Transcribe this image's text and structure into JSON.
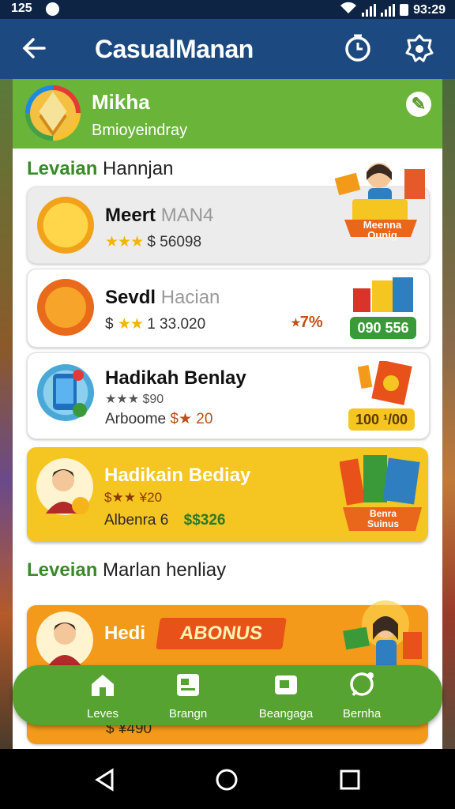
{
  "status_bar": {
    "time_left": "125",
    "time_right": "93:29"
  },
  "app_bar": {
    "back_icon": "arrow-left-icon",
    "title": "CasualManan",
    "icons": [
      "timer-icon",
      "settings-icon"
    ]
  },
  "profile": {
    "name": "Mikha",
    "subtitle": "Bmioyeindray",
    "edit_icon": "pencil-icon"
  },
  "sections": [
    {
      "title_green": "Levaian",
      "title_rest": " Hannjan"
    },
    {
      "title_green": "Leveian",
      "title_rest": " Marlan henliay"
    }
  ],
  "cards": [
    {
      "title": "Meert",
      "title_light": " MAN4",
      "stars": "★★★",
      "value": " $ 56098",
      "badge": "Meenna Ounig"
    },
    {
      "title": "Sevdl",
      "title_light": " Hacian",
      "stars": "★★",
      "value_prefix": "$ ",
      "value": " 1 33.020",
      "percent": "⭑7%",
      "pill": "090 556"
    },
    {
      "title": "Hadikah Benlay",
      "line1": "★★★ $90",
      "line2_prefix": "Arboome ",
      "line2_value": "$★ 20",
      "pill": "100 ¹/00"
    },
    {
      "title": "Hadikain Bediay",
      "line1": "$★★ ¥20",
      "line2_label": "Albenra 6",
      "line2_value": "$$326",
      "badge": "Benra Suinus"
    },
    {
      "title": "Hedi",
      "ribbon": "ABONUS",
      "footer_value": "$ ¥490"
    }
  ],
  "bottom_nav": [
    {
      "label": "Leves",
      "icon": "home-icon"
    },
    {
      "label": "Brangn",
      "icon": "board-icon"
    },
    {
      "label": "Beangaga",
      "icon": "card-icon"
    },
    {
      "label": "Bernha",
      "icon": "chat-icon"
    }
  ],
  "colors": {
    "appbar": "#1c4a80",
    "green": "#56a332",
    "yellow": "#f5c521",
    "orange": "#f39a1a"
  }
}
